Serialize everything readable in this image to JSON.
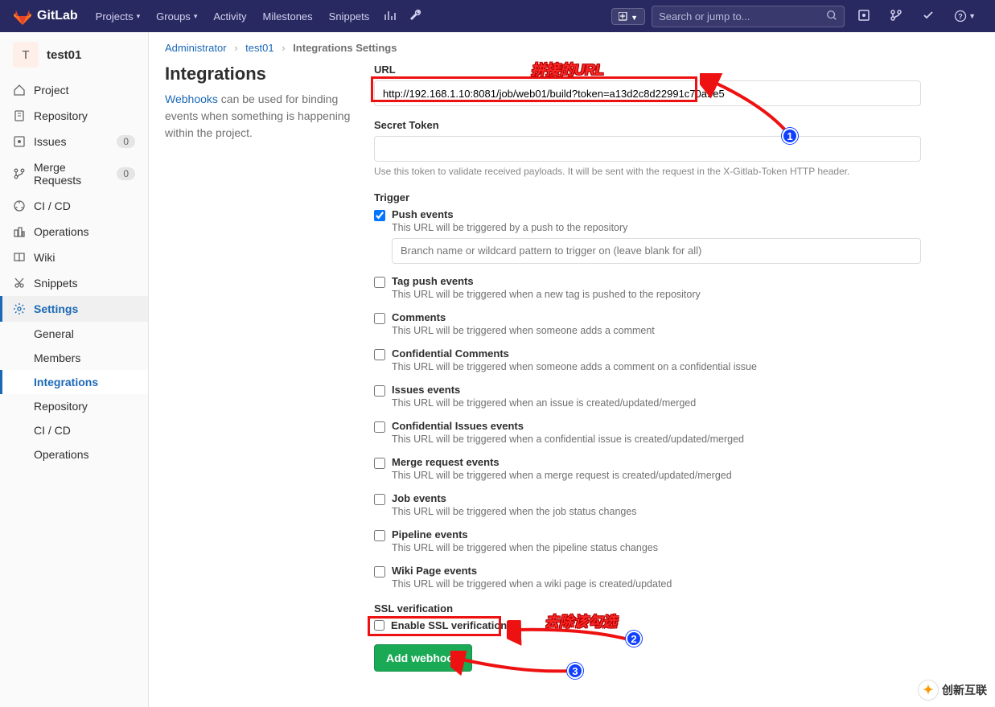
{
  "topbar": {
    "brand": "GitLab",
    "items": [
      "Projects",
      "Groups",
      "Activity",
      "Milestones",
      "Snippets"
    ],
    "search_placeholder": "Search or jump to...",
    "new_label": "",
    "help_label": "?"
  },
  "sidebar": {
    "avatar_letter": "T",
    "project_name": "test01",
    "items": [
      {
        "icon": "home",
        "label": "Project"
      },
      {
        "icon": "repo",
        "label": "Repository"
      },
      {
        "icon": "issues",
        "label": "Issues",
        "badge": "0"
      },
      {
        "icon": "merge",
        "label": "Merge Requests",
        "badge": "0"
      },
      {
        "icon": "ci",
        "label": "CI / CD"
      },
      {
        "icon": "ops",
        "label": "Operations"
      },
      {
        "icon": "wiki",
        "label": "Wiki"
      },
      {
        "icon": "snip",
        "label": "Snippets"
      },
      {
        "icon": "settings",
        "label": "Settings",
        "active": true
      }
    ],
    "sub_items": [
      "General",
      "Members",
      "Integrations",
      "Repository",
      "CI / CD",
      "Operations"
    ],
    "active_sub": "Integrations"
  },
  "breadcrumb": {
    "root": "Administrator",
    "project": "test01",
    "current": "Integrations Settings"
  },
  "left": {
    "title": "Integrations",
    "desc_link": "Webhooks",
    "desc_text": " can be used for binding events when something is happening within the project."
  },
  "form": {
    "url_label": "URL",
    "url_value": "http://192.168.1.10:8081/job/web01/build?token=a13d2c8d22991c70a9e5",
    "secret_label": "Secret Token",
    "secret_value": "",
    "secret_help": "Use this token to validate received payloads. It will be sent with the request in the X-Gitlab-Token HTTP header.",
    "trigger_label": "Trigger",
    "branch_placeholder": "Branch name or wildcard pattern to trigger on (leave blank for all)",
    "triggers": [
      {
        "title": "Push events",
        "desc": "This URL will be triggered by a push to the repository",
        "checked": true,
        "has_input": true
      },
      {
        "title": "Tag push events",
        "desc": "This URL will be triggered when a new tag is pushed to the repository"
      },
      {
        "title": "Comments",
        "desc": "This URL will be triggered when someone adds a comment"
      },
      {
        "title": "Confidential Comments",
        "desc": "This URL will be triggered when someone adds a comment on a confidential issue"
      },
      {
        "title": "Issues events",
        "desc": "This URL will be triggered when an issue is created/updated/merged"
      },
      {
        "title": "Confidential Issues events",
        "desc": "This URL will be triggered when a confidential issue is created/updated/merged"
      },
      {
        "title": "Merge request events",
        "desc": "This URL will be triggered when a merge request is created/updated/merged"
      },
      {
        "title": "Job events",
        "desc": "This URL will be triggered when the job status changes"
      },
      {
        "title": "Pipeline events",
        "desc": "This URL will be triggered when the pipeline status changes"
      },
      {
        "title": "Wiki Page events",
        "desc": "This URL will be triggered when a wiki page is created/updated"
      }
    ],
    "ssl_label": "SSL verification",
    "ssl_check_label": "Enable SSL verification",
    "submit": "Add webhook"
  },
  "annotations": {
    "url_anno": "拼接的URL",
    "ssl_anno": "去除该勾选",
    "n1": "1",
    "n2": "2",
    "n3": "3"
  },
  "watermark": "创新互联"
}
